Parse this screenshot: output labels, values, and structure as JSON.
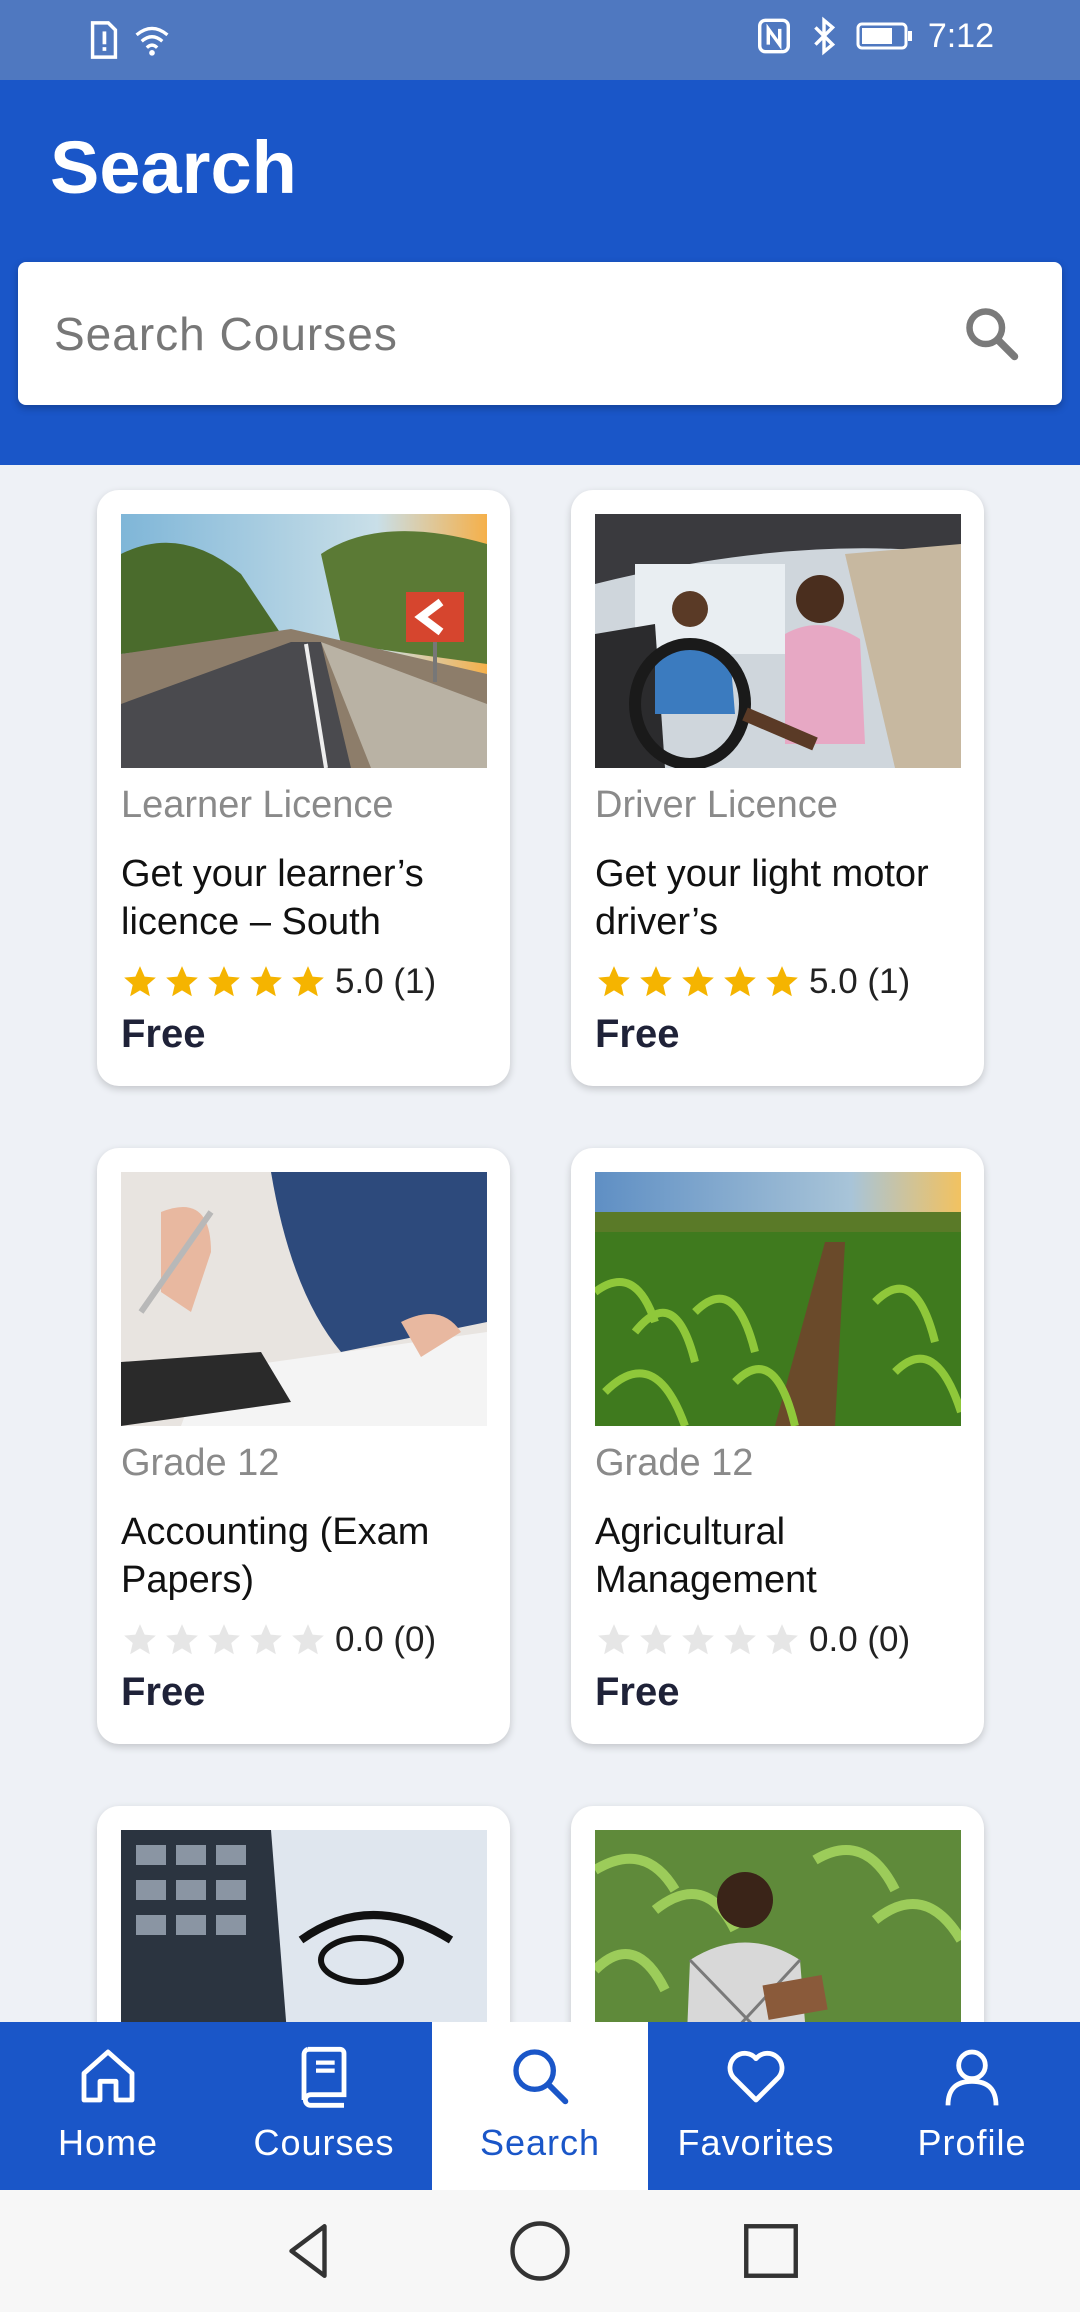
{
  "status_bar": {
    "time": "7:12"
  },
  "header": {
    "title": "Search"
  },
  "search": {
    "placeholder": "Search Courses",
    "value": ""
  },
  "courses": [
    {
      "category": "Learner Licence",
      "title": "Get your learner’s licence – South",
      "rating_text": "5.0 (1)",
      "stars": 5,
      "price": "Free",
      "image": "road-image"
    },
    {
      "category": "Driver Licence",
      "title": "Get your light motor driver’s",
      "rating_text": "5.0 (1)",
      "stars": 5,
      "price": "Free",
      "image": "car-drivers-image"
    },
    {
      "category": "Grade 12",
      "title": "Accounting (Exam Papers)",
      "rating_text": "0.0 (0)",
      "stars": 0,
      "price": "Free",
      "image": "calculator-hands-image"
    },
    {
      "category": "Grade 12",
      "title": "Agricultural Management",
      "rating_text": "0.0 (0)",
      "stars": 0,
      "price": "Free",
      "image": "cornfield-image"
    },
    {
      "image": "calculator-glasses-image"
    },
    {
      "image": "farmer-image"
    }
  ],
  "nav": {
    "items": [
      {
        "label": "Home",
        "icon": "home-icon"
      },
      {
        "label": "Courses",
        "icon": "book-icon"
      },
      {
        "label": "Search",
        "icon": "search-icon"
      },
      {
        "label": "Favorites",
        "icon": "heart-icon"
      },
      {
        "label": "Profile",
        "icon": "person-icon"
      }
    ],
    "active": "Search"
  },
  "colors": {
    "primary": "#1a56c8",
    "status_bar": "#4f78c0",
    "star": "#f5b400",
    "star_empty": "#e6e6e6",
    "background": "#eef1f6"
  }
}
